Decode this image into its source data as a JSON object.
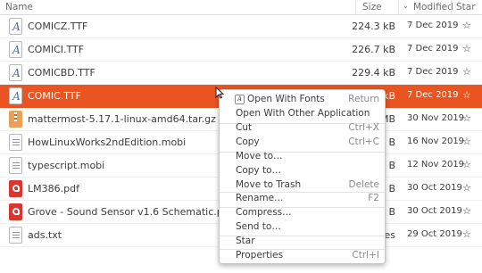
{
  "columns": {
    "name": "Name",
    "size": "Size",
    "modified": "Modified",
    "star": "Star",
    "sort_arrow": "⌄"
  },
  "files": [
    {
      "name": "COMICZ.TTF",
      "size": "224.3 kB",
      "modified": "7 Dec 2019",
      "type": "font-icon",
      "selected": false
    },
    {
      "name": "COMICI.TTF",
      "size": "226.7 kB",
      "modified": "7 Dec 2019",
      "type": "font-icon",
      "selected": false
    },
    {
      "name": "COMICBD.TTF",
      "size": "229.4 kB",
      "modified": "7 Dec 2019",
      "type": "font-icon",
      "selected": false
    },
    {
      "name": "COMIC.TTF",
      "size": "kB",
      "modified": "7 Dec 2019",
      "type": "font-icon",
      "selected": true
    },
    {
      "name": "mattermost-5.17.1-linux-amd64.tar.gz",
      "size": "MB",
      "modified": "30 Nov 2019",
      "type": "archive-icon",
      "selected": false
    },
    {
      "name": "HowLinuxWorks2ndEdition.mobi",
      "size": "B",
      "modified": "16 Nov 2019",
      "type": "document-icon",
      "selected": false
    },
    {
      "name": "typescript.mobi",
      "size": "B",
      "modified": "12 Nov 2019",
      "type": "document-icon",
      "selected": false
    },
    {
      "name": "LM386.pdf",
      "size": "B",
      "modified": "30 Oct 2019",
      "type": "pdf-icon",
      "selected": false
    },
    {
      "name": "Grove - Sound Sensor v1.6 Schematic.pdf",
      "size": "B",
      "modified": "30 Oct 2019",
      "type": "pdf-icon",
      "selected": false
    },
    {
      "name": "ads.txt",
      "size": "es",
      "modified": "29 Oct 2019",
      "type": "text-icon",
      "selected": false
    }
  ],
  "star_glyph": "☆",
  "context_menu": {
    "open_with_fonts": {
      "label": "Open With Fonts",
      "accel": "Return"
    },
    "open_with_other": {
      "label": "Open With Other Application",
      "accel": ""
    },
    "cut": {
      "label": "Cut",
      "accel": "Ctrl+X"
    },
    "copy": {
      "label": "Copy",
      "accel": "Ctrl+C"
    },
    "move_to": {
      "label": "Move to…",
      "accel": ""
    },
    "copy_to": {
      "label": "Copy to…",
      "accel": ""
    },
    "move_to_trash": {
      "label": "Move to Trash",
      "accel": "Delete"
    },
    "rename": {
      "label": "Rename…",
      "accel": "F2"
    },
    "compress": {
      "label": "Compress…",
      "accel": ""
    },
    "send_to": {
      "label": "Send to…",
      "accel": ""
    },
    "star": {
      "label": "Star",
      "accel": ""
    },
    "properties": {
      "label": "Properties",
      "accel": "Ctrl+I"
    }
  },
  "colors": {
    "selection": "#e95420",
    "font_icon": "#4a6fb3",
    "pdf_icon": "#d8362f",
    "archive_icon": "#e8a15b"
  }
}
